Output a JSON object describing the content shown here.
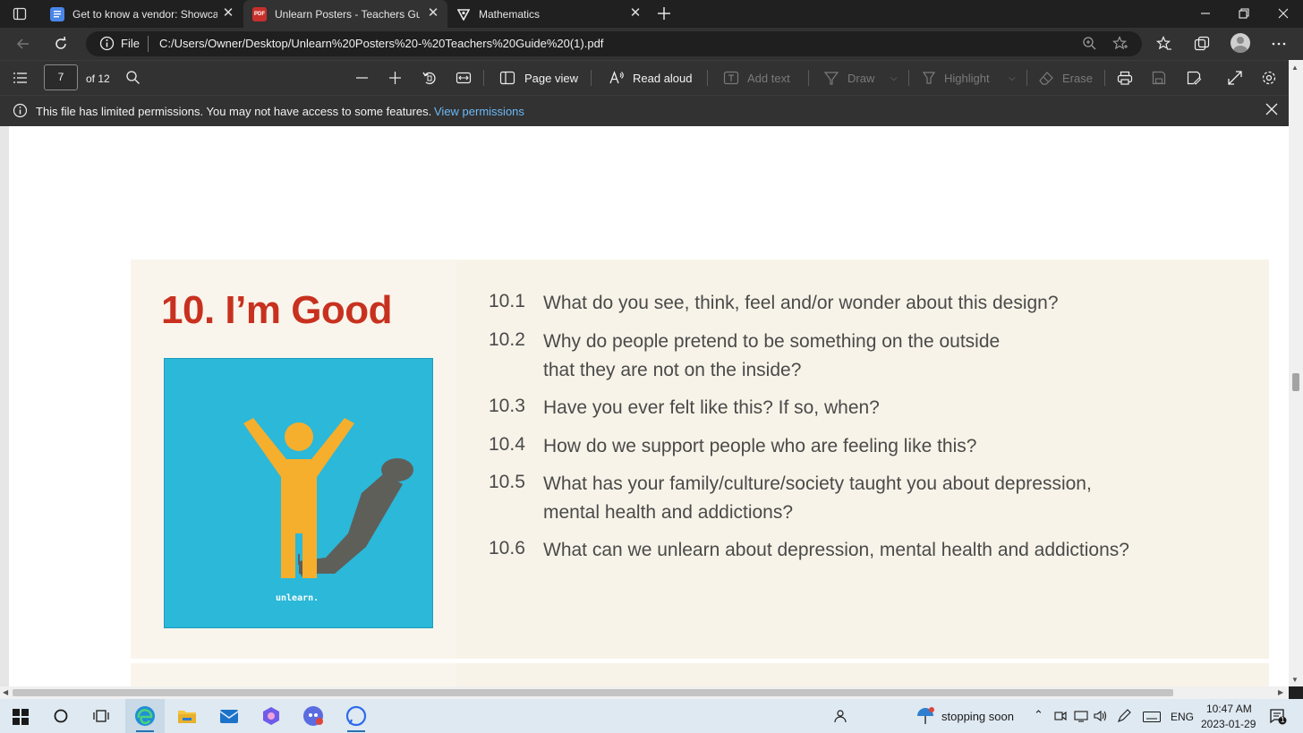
{
  "browser": {
    "tabs": [
      {
        "title": "Get to know a vendor: Showcasin",
        "icon": "google-docs-icon",
        "active": false
      },
      {
        "title": "Unlearn Posters - Teachers Guide",
        "icon": "pdf-icon",
        "active": true
      },
      {
        "title": "Mathematics",
        "icon": "site-icon",
        "active": false
      }
    ],
    "address": {
      "scheme_label": "File",
      "url": "C:/Users/Owner/Desktop/Unlearn%20Posters%20-%20Teachers%20Guide%20(1).pdf"
    }
  },
  "pdf_toolbar": {
    "page_input": "7",
    "page_total": "of 12",
    "page_view_label": "Page view",
    "read_aloud_label": "Read aloud",
    "add_text_label": "Add text",
    "draw_label": "Draw",
    "highlight_label": "Highlight",
    "erase_label": "Erase"
  },
  "infobar": {
    "message": "This file has limited permissions. You may not have access to some features.",
    "link": "View permissions"
  },
  "document": {
    "section_title": "10. I’m Good",
    "poster_brand": "unlearn.",
    "questions": [
      {
        "num": "10.1",
        "lines": [
          "What do you see, think, feel and/or wonder about this design?"
        ]
      },
      {
        "num": "10.2",
        "lines": [
          "Why do people pretend to be something on the outside",
          "that they are not on the inside?"
        ]
      },
      {
        "num": "10.3",
        "lines": [
          "Have you ever felt like this? If so, when?"
        ]
      },
      {
        "num": "10.4",
        "lines": [
          "How do we support people who are feeling like this?"
        ]
      },
      {
        "num": "10.5",
        "lines": [
          "What has your family/culture/society taught you about depression,",
          "mental health and addictions?"
        ]
      },
      {
        "num": "10.6",
        "lines": [
          "What can we unlearn about depression, mental health and addictions?"
        ]
      }
    ]
  },
  "taskbar": {
    "weather_text": "stopping soon",
    "language": "ENG",
    "time": "10:47 AM",
    "date": "2023-01-29",
    "notification_count": "1"
  },
  "colors": {
    "title_red": "#c8311f",
    "poster_blue": "#2bb8d9",
    "figure_orange": "#f6ae2d",
    "shadow_gray": "#5f5f5a",
    "card_bg": "#f8f3e8",
    "link_blue": "#6cb8f6"
  }
}
